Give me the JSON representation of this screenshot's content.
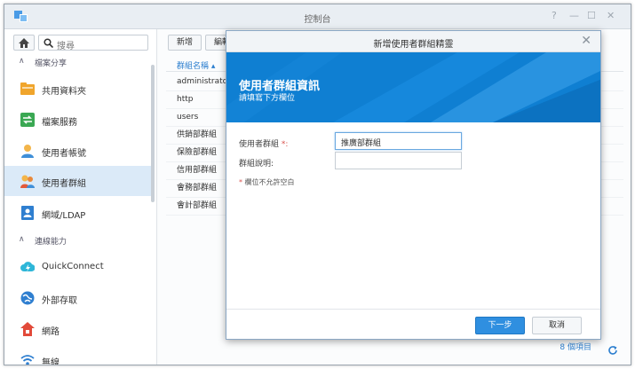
{
  "window": {
    "title": "控制台",
    "controls": [
      "?",
      "—",
      "☐",
      "✕"
    ]
  },
  "sidebar": {
    "search_placeholder": "搜尋",
    "sections": [
      {
        "label": "檔案分享"
      },
      {
        "label": "連線能力"
      }
    ],
    "items": [
      {
        "label": "共用資料夾",
        "icon": "folder-icon"
      },
      {
        "label": "檔案服務",
        "icon": "file-services-icon"
      },
      {
        "label": "使用者帳號",
        "icon": "user-icon"
      },
      {
        "label": "使用者群組",
        "icon": "group-icon",
        "active": true
      },
      {
        "label": "網域/LDAP",
        "icon": "domain-icon"
      },
      {
        "label": "QuickConnect",
        "icon": "quickconnect-icon"
      },
      {
        "label": "外部存取",
        "icon": "external-access-icon"
      },
      {
        "label": "網路",
        "icon": "network-icon"
      },
      {
        "label": "無線",
        "icon": "wireless-icon"
      }
    ]
  },
  "main": {
    "toolbar": {
      "add": "新增",
      "edit": "編輯"
    },
    "column_header": "群組名稱 ▴",
    "rows": [
      "administrators",
      "http",
      "users",
      "供銷部群組",
      "保險部群組",
      "信用部群組",
      "會務部群組",
      "會計部群組"
    ],
    "count": "8 個項目"
  },
  "dialog": {
    "title": "新增使用者群組精靈",
    "heading": "使用者群組資訊",
    "subheading": "請填寫下方欄位",
    "fields": {
      "name_label": "使用者群組",
      "name_required": " *:",
      "name_value": "推廣部群組",
      "desc_label": "群組說明:",
      "desc_value": ""
    },
    "note": "* 欄位不允許空白",
    "next": "下一步",
    "cancel": "取消"
  },
  "colors": {
    "accent": "#0f7fd2",
    "active_bg": "#dbeaf8",
    "link": "#2d7fcf"
  }
}
